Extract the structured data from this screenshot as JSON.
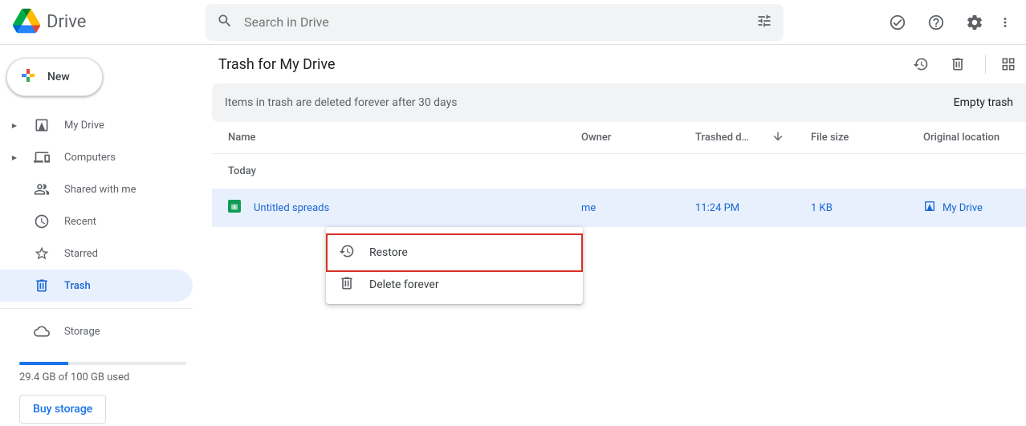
{
  "app_name": "Drive",
  "search": {
    "placeholder": "Search in Drive"
  },
  "new_button_label": "New",
  "sidebar": {
    "items": [
      {
        "label": "My Drive",
        "has_arrow": true
      },
      {
        "label": "Computers",
        "has_arrow": true
      },
      {
        "label": "Shared with me",
        "has_arrow": false
      },
      {
        "label": "Recent",
        "has_arrow": false
      },
      {
        "label": "Starred",
        "has_arrow": false
      },
      {
        "label": "Trash",
        "has_arrow": false,
        "active": true
      }
    ],
    "storage_label": "Storage",
    "storage_used_text": "29.4 GB of 100 GB used",
    "buy_storage_label": "Buy storage"
  },
  "main": {
    "title": "Trash for My Drive",
    "banner_text": "Items in trash are deleted forever after 30 days",
    "banner_action": "Empty trash",
    "columns": {
      "name": "Name",
      "owner": "Owner",
      "trashed": "Trashed d…",
      "size": "File size",
      "location": "Original location"
    },
    "group_label": "Today",
    "row": {
      "name": "Untitled spreads",
      "owner": "me",
      "trashed": "11:24 PM",
      "size": "1 KB",
      "location": "My Drive"
    }
  },
  "context_menu": {
    "restore": "Restore",
    "delete_forever": "Delete forever"
  }
}
